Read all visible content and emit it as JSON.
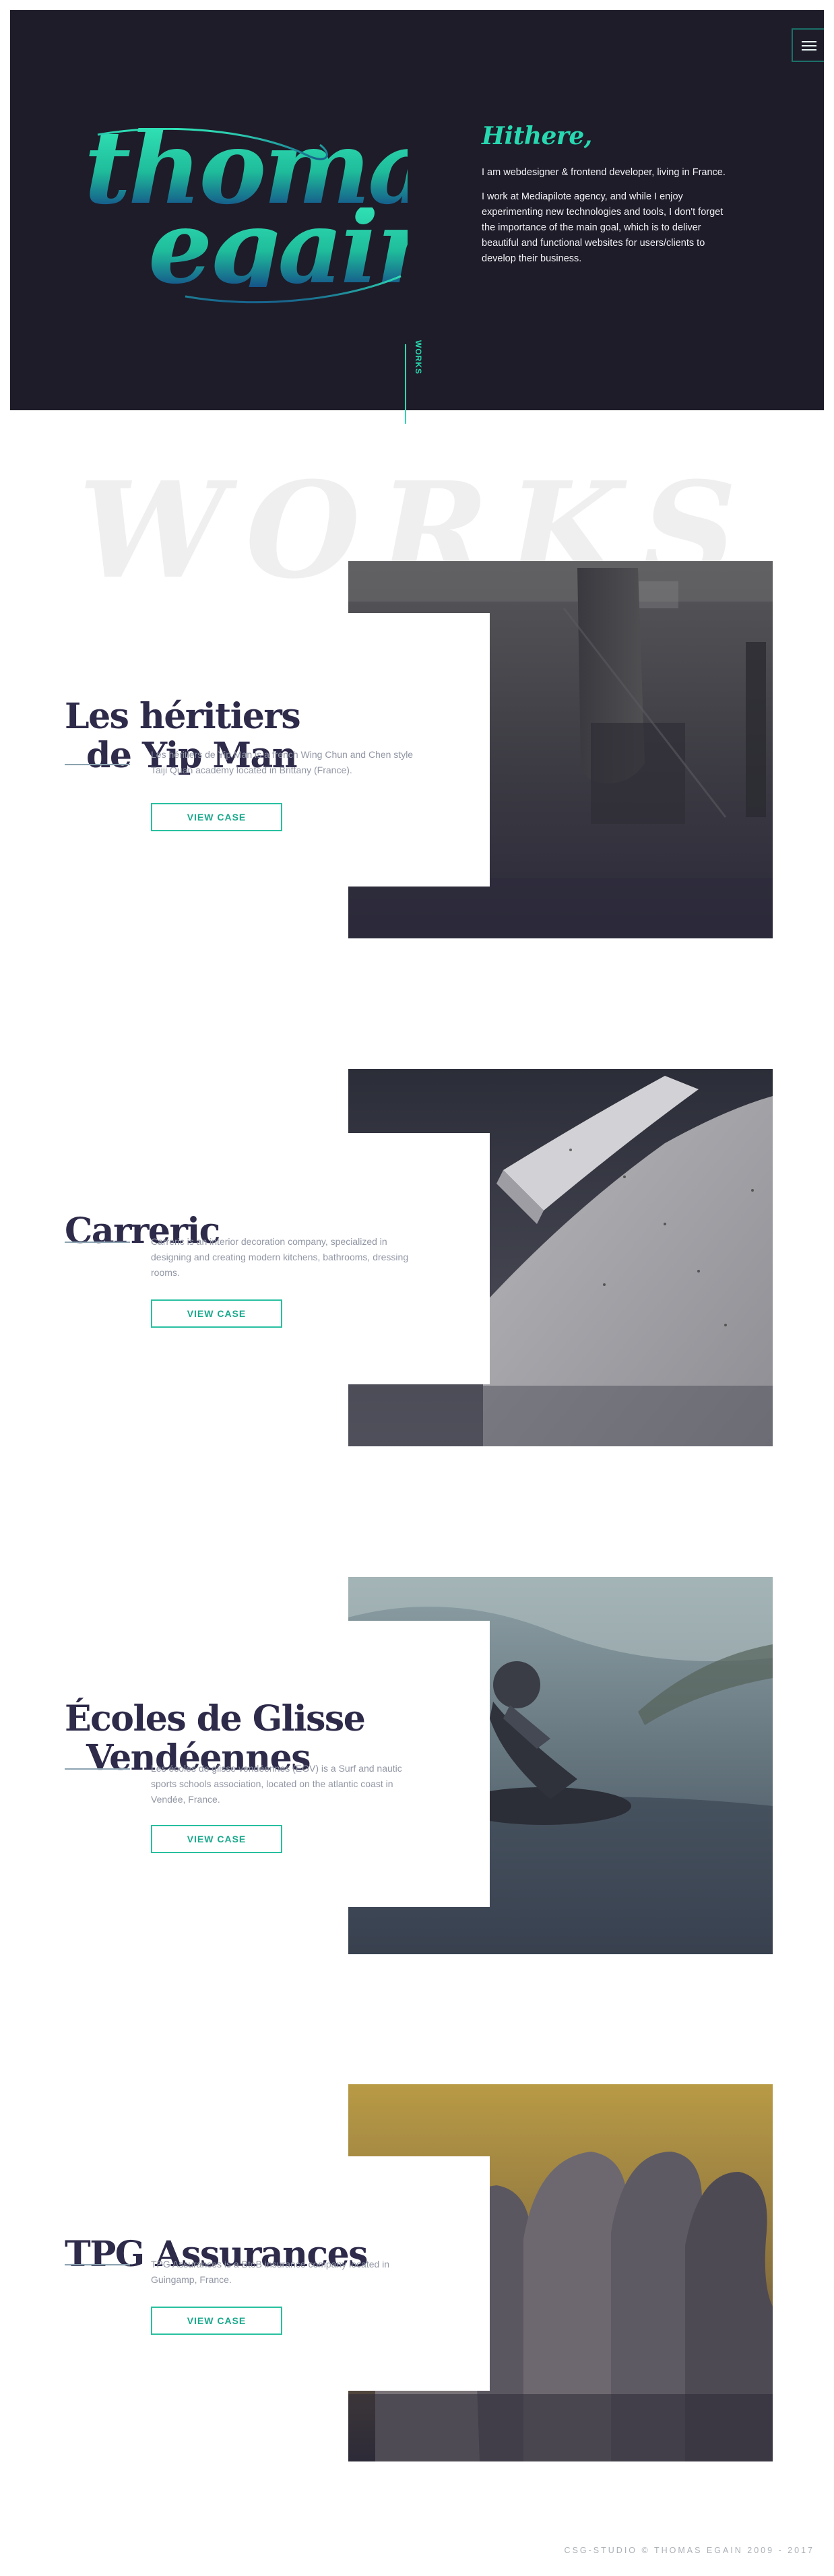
{
  "hero": {
    "logo_line1": "thomas",
    "logo_line2": "egain",
    "greeting": "Hithere,",
    "paragraph1": "I am webdesigner & frontend developer, living in France.",
    "paragraph2": "I work at Mediapilote agency, and while I enjoy experimenting new technologies and tools, I don't forget the importance of the main goal, which is to deliver beautiful and functional websites for users/clients to develop their business.",
    "works_link": "WORKS",
    "menu_icon": "hamburger-menu-icon"
  },
  "works_watermark": "WORKS",
  "projects": [
    {
      "title_line1": "Les héritiers",
      "title_line2": "de Yip Man",
      "description": "Les héritiers de Yip Man is a french Wing Chun and Chen style Taiji Quan academy located in Brittany (France).",
      "button": "VIEW CASE",
      "image": "martial-arts-gym-photo"
    },
    {
      "title_line1": "Carreric",
      "title_line2": "",
      "description": "Carreric is an interior decoration company, specialized in designing and creating modern kitchens, bathrooms, dressing rooms.",
      "button": "VIEW CASE",
      "image": "stone-countertop-photo"
    },
    {
      "title_line1": "Écoles de Glisse",
      "title_line2": "Vendéennes",
      "description": "Les écoles de glisse vendéennes (EGV) is a Surf and nautic sports schools association, located on the atlantic coast in Vendée, France.",
      "button": "VIEW CASE",
      "image": "bodyboard-surfer-photo"
    },
    {
      "title_line1": "TPG Assurances",
      "title_line2": "",
      "description": "TPG Assurances is a BtoB insurance company located in Guingamp, France.",
      "button": "VIEW CASE",
      "image": "business-people-profiles-photo"
    }
  ],
  "footer": "CSG-STUDIO © THOMAS EGAIN 2009 - 2017",
  "colors": {
    "hero_bg": "#1e1c29",
    "accent": "#28d8b0",
    "title": "#2d2a4a",
    "muted_text": "#9196a4"
  }
}
